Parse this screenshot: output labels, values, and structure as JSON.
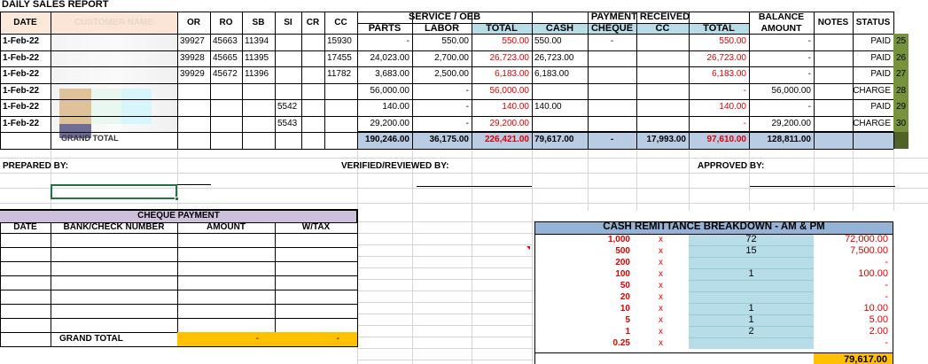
{
  "title": "DAILY SALES REPORT",
  "headers": {
    "date": "DATE",
    "customer": "CUSTOMER NAME",
    "or": "OR",
    "ro": "RO",
    "sb": "SB",
    "si": "SI",
    "cr": "CR",
    "cc": "CC",
    "service_group": "SERVICE / OEB",
    "parts": "PARTS",
    "labor": "LABOR",
    "total": "TOTAL",
    "payment_group": "PAYMENT RECEIVED",
    "cash": "CASH",
    "cheque": "CHEQUE",
    "cc2": "CC",
    "total2": "TOTAL",
    "balance": "BALANCE AMOUNT",
    "notes": "NOTES",
    "status": "STATUS"
  },
  "rows": [
    {
      "date": "1-Feb-22",
      "or": "39927",
      "ro": "45663",
      "sb": "11394",
      "si": "",
      "cr": "",
      "cc": "15930",
      "parts": "-",
      "labor": "550.00",
      "total": "550.00",
      "cash": "550.00",
      "cheque": "-",
      "cc_pay": "",
      "total_pay": "550.00",
      "balance": "-",
      "notes": "",
      "status": "PAID",
      "num": "25"
    },
    {
      "date": "1-Feb-22",
      "or": "39928",
      "ro": "45665",
      "sb": "11395",
      "si": "",
      "cr": "",
      "cc": "17455",
      "parts": "24,023.00",
      "labor": "2,700.00",
      "total": "26,723.00",
      "cash": "26,723.00",
      "cheque": "",
      "cc_pay": "",
      "total_pay": "26,723.00",
      "balance": "-",
      "notes": "",
      "status": "PAID",
      "num": "26"
    },
    {
      "date": "1-Feb-22",
      "or": "39929",
      "ro": "45672",
      "sb": "11396",
      "si": "",
      "cr": "",
      "cc": "11782",
      "parts": "3,683.00",
      "labor": "2,500.00",
      "total": "6,183.00",
      "cash": "6,183.00",
      "cheque": "",
      "cc_pay": "",
      "total_pay": "6,183.00",
      "balance": "-",
      "notes": "",
      "status": "PAID",
      "num": "27"
    },
    {
      "date": "1-Feb-22",
      "or": "",
      "ro": "",
      "sb": "",
      "si": "",
      "cr": "",
      "cc": "",
      "parts": "56,000.00",
      "labor": "-",
      "total": "56,000.00",
      "cash": "",
      "cheque": "",
      "cc_pay": "",
      "total_pay": "-",
      "balance": "56,000.00",
      "notes": "",
      "status": "CHARGE",
      "num": "28"
    },
    {
      "date": "1-Feb-22",
      "or": "",
      "ro": "",
      "sb": "",
      "si": "5542",
      "cr": "",
      "cc": "",
      "parts": "140.00",
      "labor": "-",
      "total": "140.00",
      "cash": "140.00",
      "cheque": "",
      "cc_pay": "",
      "total_pay": "140.00",
      "balance": "-",
      "notes": "",
      "status": "PAID",
      "num": "29"
    },
    {
      "date": "1-Feb-22",
      "or": "",
      "ro": "",
      "sb": "",
      "si": "5543",
      "cr": "",
      "cc": "",
      "parts": "29,200.00",
      "labor": "-",
      "total": "29,200.00",
      "cash": "",
      "cheque": "",
      "cc_pay": "",
      "total_pay": "-",
      "balance": "29,200.00",
      "notes": "",
      "status": "CHARGE",
      "num": "30"
    }
  ],
  "grand_total": {
    "label": "GRAND TOTAL",
    "parts": "190,246.00",
    "labor": "36,175.00",
    "total": "226,421.00",
    "cash": "79,617.00",
    "cheque": "-",
    "cc_pay": "17,993.00",
    "total_pay": "97,610.00",
    "balance": "128,811.00"
  },
  "signatures": {
    "prepared": "PREPARED BY:",
    "verified": "VERIFIED/REVIEWED BY:",
    "approved": "APPROVED BY:"
  },
  "cheque_payment": {
    "title": "CHEQUE PAYMENT",
    "col_date": "DATE",
    "col_bank": "BANK/CHECK NUMBER",
    "col_amount": "AMOUNT",
    "col_wtax": "W/TAX",
    "total_label": "GRAND TOTAL",
    "total_amount": "-",
    "total_wtax": "-"
  },
  "cash_remittance": {
    "title": "CASH REMITTANCE BREAKDOWN - AM & PM",
    "rows": [
      {
        "denom": "1,000",
        "x": "x",
        "qty": "72",
        "amount": "72,000.00"
      },
      {
        "denom": "500",
        "x": "x",
        "qty": "15",
        "amount": "7,500.00"
      },
      {
        "denom": "200",
        "x": "x",
        "qty": "",
        "amount": "-"
      },
      {
        "denom": "100",
        "x": "x",
        "qty": "1",
        "amount": "100.00"
      },
      {
        "denom": "50",
        "x": "x",
        "qty": "",
        "amount": "-"
      },
      {
        "denom": "20",
        "x": "x",
        "qty": "",
        "amount": "-"
      },
      {
        "denom": "10",
        "x": "x",
        "qty": "1",
        "amount": "10.00"
      },
      {
        "denom": "5",
        "x": "x",
        "qty": "1",
        "amount": "5.00"
      },
      {
        "denom": "1",
        "x": "x",
        "qty": "2",
        "amount": "2.00"
      },
      {
        "denom": "0.25",
        "x": "x",
        "qty": "",
        "amount": "-"
      }
    ],
    "total": "79,617.00"
  },
  "colors": {
    "header_peach": "#fde9d9",
    "light_blue": "#b7dee8",
    "total_blue": "#b8cce4",
    "lavender": "#ccc0da",
    "orange": "#ffc000",
    "row_num_green": "#4f6228",
    "red": "#e00000"
  }
}
